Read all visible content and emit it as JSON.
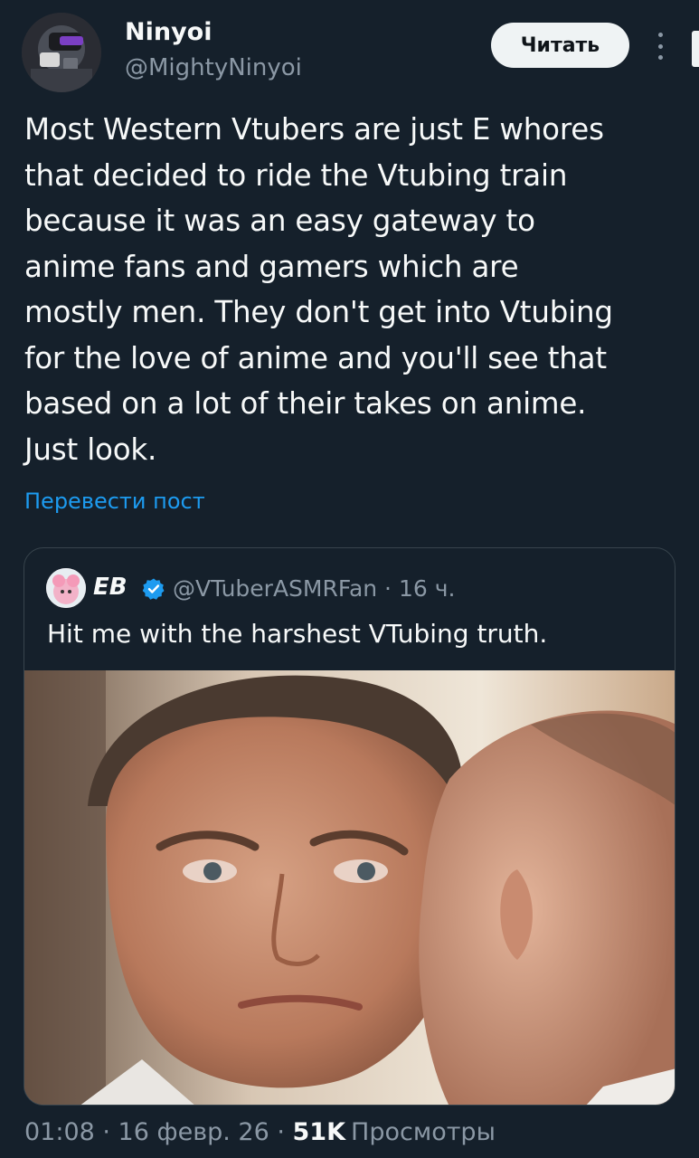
{
  "author": {
    "name": "Ninyoi",
    "handle": "@MightyNinyoi",
    "avatar_icon": "profile-avatar-icon"
  },
  "follow_button_label": "Читать",
  "more_icon": "more-vertical-icon",
  "tweet": {
    "lines": [
      "Most Western Vtubers are just E whores",
      "that decided to ride the Vtubing train",
      "because it was an easy gateway to",
      "anime fans and gamers which are",
      "mostly men. They don't get into Vtubing",
      "for the love of anime and you'll see that",
      "based on a lot of their takes on anime.",
      "Just look."
    ],
    "translate_label": "Перевести пост"
  },
  "quote": {
    "name": "EB",
    "verified_icon": "verified-badge-icon",
    "handle_time": "@VTuberASMRFan · 16 ч.",
    "text": "Hit me with the harshest VTubing truth.",
    "media_icon": "photo-image"
  },
  "meta": {
    "time_date": "01:08 · 16 февр. 26 · ",
    "views_count": "51K",
    "views_label": "Просмотры"
  },
  "colors": {
    "background": "#15202b",
    "accent": "#1d9bf0",
    "secondary_text": "#8b98a5",
    "border": "#38444d"
  }
}
